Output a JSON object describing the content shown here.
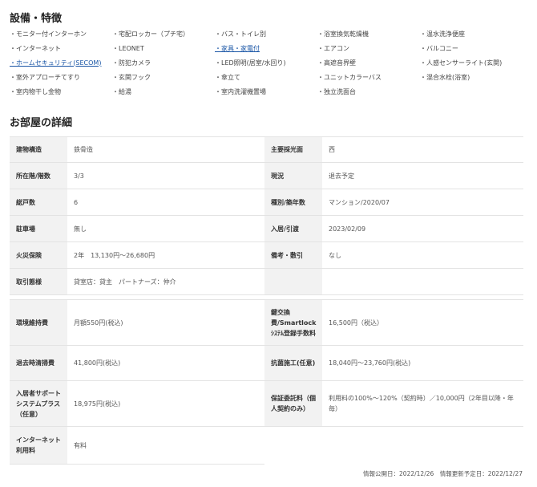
{
  "features": {
    "title": "設備・特徴",
    "rows": [
      [
        {
          "label": "・モニター付インターホン",
          "link": false
        },
        {
          "label": "・宅配ロッカー（プチ宅）",
          "link": false
        },
        {
          "label": "・バス・トイレ別",
          "link": false
        },
        {
          "label": "・浴室換気乾燥機",
          "link": false
        },
        {
          "label": "・温水洗浄便座",
          "link": false
        }
      ],
      [
        {
          "label": "・インターネット",
          "link": false
        },
        {
          "label": "・LEONET",
          "link": false
        },
        {
          "label": "・家具・家電付",
          "link": true
        },
        {
          "label": "・エアコン",
          "link": false
        },
        {
          "label": "・バルコニー",
          "link": false
        }
      ],
      [
        {
          "label": "・ホームセキュリティ(SECOM)",
          "link": true
        },
        {
          "label": "・防犯カメラ",
          "link": false
        },
        {
          "label": "・LED照明(居室/水回り)",
          "link": false
        },
        {
          "label": "・高遮音界壁",
          "link": false
        },
        {
          "label": "・人感センサーライト(玄関)",
          "link": false
        }
      ],
      [
        {
          "label": "・室外アプローチてすり",
          "link": false
        },
        {
          "label": "・玄関フック",
          "link": false
        },
        {
          "label": "・傘立て",
          "link": false
        },
        {
          "label": "・ユニットカラーバス",
          "link": false
        },
        {
          "label": "・混合水栓(浴室)",
          "link": false
        }
      ],
      [
        {
          "label": "・室内物干し金物",
          "link": false
        },
        {
          "label": "・給湯",
          "link": false
        },
        {
          "label": "・室内洗濯機置場",
          "link": false
        },
        {
          "label": "・独立洗面台",
          "link": false
        }
      ]
    ]
  },
  "details": {
    "title": "お部屋の詳細",
    "table1": [
      {
        "l1": "建物構造",
        "v1": "鉄骨造",
        "l2": "主要採光面",
        "v2": "西"
      },
      {
        "l1": "所在階/階数",
        "v1": "3/3",
        "l2": "現況",
        "v2": "退去予定"
      },
      {
        "l1": "総戸数",
        "v1": "6",
        "l2": "種別/築年数",
        "v2": "マンション/2020/07"
      },
      {
        "l1": "駐車場",
        "v1": "無し",
        "l2": "入居/引渡",
        "v2": "2023/02/09"
      },
      {
        "l1": "火災保険",
        "v1": "2年　13,130円〜26,680円",
        "l2": "備考・敷引",
        "v2": "なし"
      },
      {
        "l1": "取引態様",
        "v1": "貸室店：貸主　パートナーズ：仲介",
        "l2": "",
        "v2": ""
      }
    ],
    "table2": [
      {
        "l1": "環境維持費",
        "v1": "月額550円(税込)",
        "l2": "鍵交換費/Smartlockｼｽﾃﾑ登録手数料",
        "v2": "16,500円（税込）"
      },
      {
        "l1": "退去時清掃費",
        "v1": "41,800円(税込)",
        "l2": "抗菌施工(任意)",
        "v2": "18,040円〜23,760円(税込)"
      },
      {
        "l1": "入居者サポートシステムプラス（任意）",
        "v1": "18,975円(税込)",
        "l2": "保証委託料（個人契約のみ）",
        "v2": "利用料の100%〜120%（契約時）／10,000円（2年目以降・年毎）"
      },
      {
        "l1": "インターネット利用料",
        "v1": "有料",
        "l2": "",
        "v2": ""
      }
    ]
  },
  "footer": {
    "text": "情報公開日：2022/12/26　情報更新予定日：2022/12/27"
  }
}
